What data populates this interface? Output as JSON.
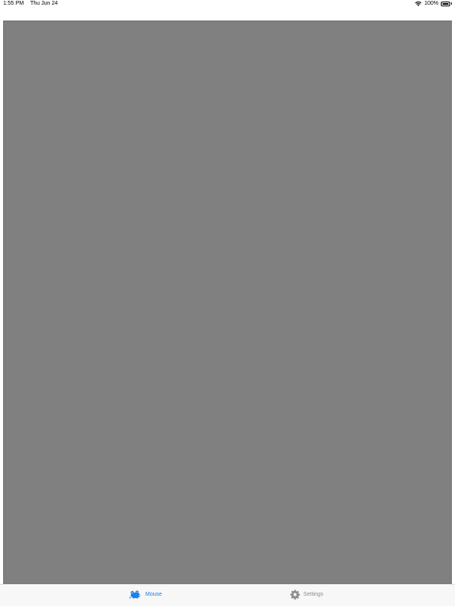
{
  "status_bar": {
    "time": "1:55 PM",
    "date": "Thu Jun 24",
    "battery_percent": "100%",
    "battery_level": 1.0,
    "wifi_icon": "wifi-icon",
    "battery_icon": "battery-icon"
  },
  "colors": {
    "content_background": "#808080",
    "tab_active": "#1a82e6",
    "tab_inactive": "#8e8e93"
  },
  "tabs": [
    {
      "label": "Mouse",
      "icon": "mouse-icon",
      "active": true
    },
    {
      "label": "Settings",
      "icon": "gear-icon",
      "active": false
    }
  ]
}
